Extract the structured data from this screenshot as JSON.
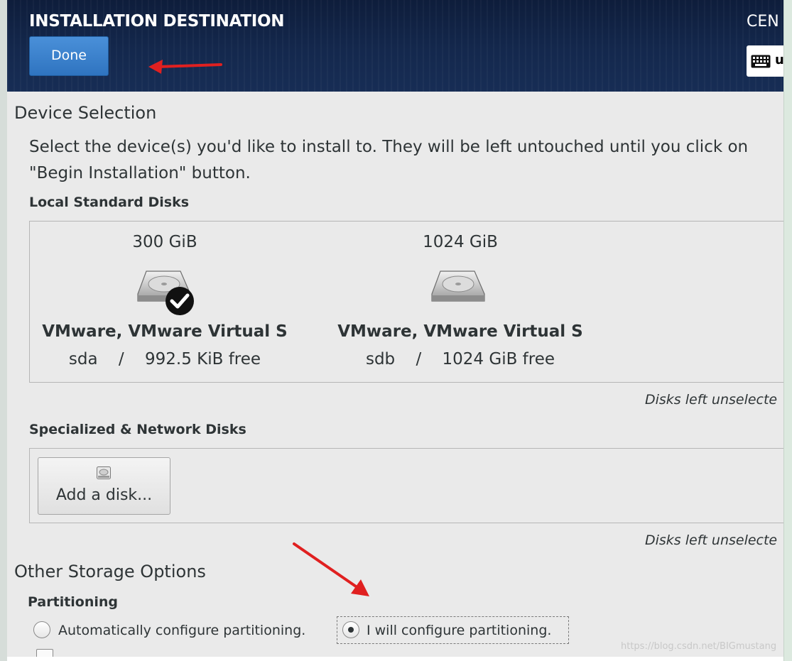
{
  "header": {
    "title": "INSTALLATION DESTINATION",
    "done_label": "Done",
    "product_name": "CEN",
    "keyboard_layout": "u"
  },
  "device_selection": {
    "heading": "Device Selection",
    "description_line1": "Select the device(s) you'd like to install to.  They will be left untouched until you click on",
    "description_line2": "\"Begin Installation\" button.",
    "local_disks_heading": "Local Standard Disks",
    "disks": [
      {
        "size": "300 GiB",
        "name": "VMware, VMware Virtual S",
        "device": "sda",
        "separator": "/",
        "free": "992.5 KiB free",
        "selected": true
      },
      {
        "size": "1024 GiB",
        "name": "VMware, VMware Virtual S",
        "device": "sdb",
        "separator": "/",
        "free": "1024 GiB free",
        "selected": false
      }
    ],
    "local_note": "Disks left unselecte",
    "specialized_heading": "Specialized & Network Disks",
    "add_disk_label": "Add a disk...",
    "specialized_note": "Disks left unselecte"
  },
  "storage_options": {
    "heading": "Other Storage Options",
    "partitioning_heading": "Partitioning",
    "auto_label": "Automatically configure partitioning.",
    "manual_label": "I will configure partitioning.",
    "selected_option": "manual"
  },
  "watermark": "https://blog.csdn.net/BIGmustang",
  "colors": {
    "header_bg": "#14284d",
    "done_button": "#3b82cc",
    "content_bg": "#eaeaea",
    "annotation_arrow": "#e02020"
  }
}
